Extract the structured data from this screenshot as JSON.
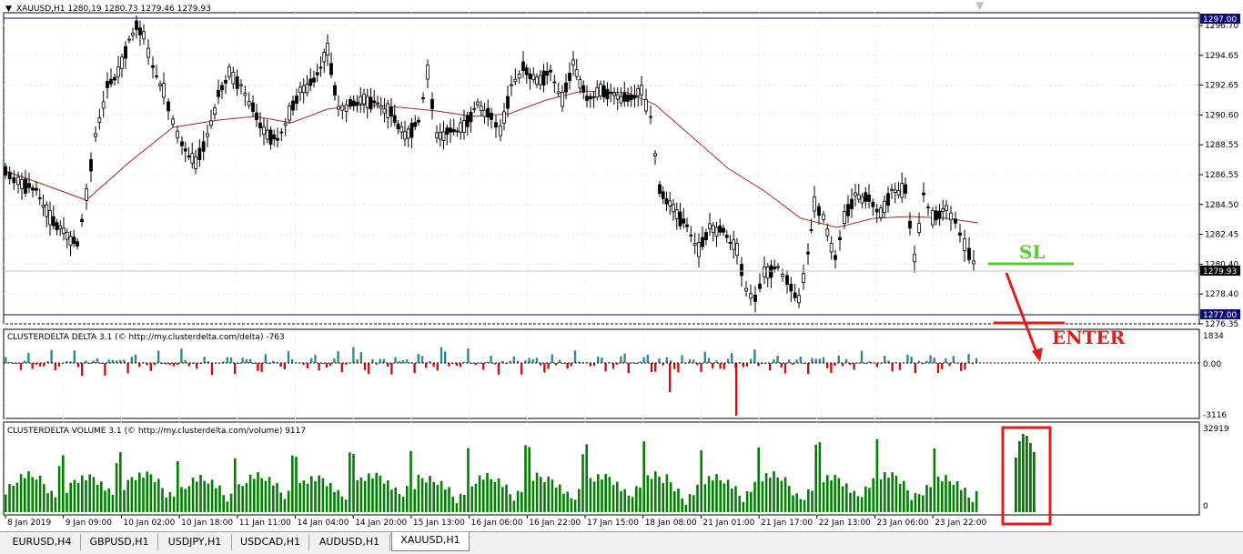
{
  "symbol_header": "XAUUSD,H1  1280,19 1280.73 1279.46 1279.93",
  "price_axis": {
    "labels": [
      "1296.70",
      "1294.65",
      "1292.65",
      "1290.60",
      "1288.55",
      "1286.55",
      "1284.50",
      "1282.45",
      "1280.40",
      "1278.40",
      "1276.35"
    ],
    "top_marker": "1297.00",
    "current_marker": "1279.93",
    "low_marker": "1277.00"
  },
  "annotations": {
    "sl": "SL",
    "enter": "ENTER"
  },
  "delta_indicator": {
    "title": "CLUSTERDELTA DELTA 3.1 (© http://my.clusterdelta.com/delta) -763",
    "axis_top": "1834",
    "axis_mid": "0.00",
    "axis_bottom": "-3116"
  },
  "volume_indicator": {
    "title": "CLUSTERDELTA VOLUME 3.1 (© http://my.clusterdelta.com/volume) 9117",
    "axis_top": "32919",
    "axis_bottom": "0"
  },
  "time_axis": [
    "8 Jan 2019",
    "9 Jan 09:00",
    "10 Jan 02:00",
    "10 Jan 18:00",
    "11 Jan 11:00",
    "14 Jan 04:00",
    "14 Jan 20:00",
    "15 Jan 13:00",
    "16 Jan 06:00",
    "16 Jan 22:00",
    "17 Jan 15:00",
    "18 Jan 08:00",
    "21 Jan 01:00",
    "21 Jan 17:00",
    "22 Jan 13:00",
    "23 Jan 06:00",
    "23 Jan 22:00"
  ],
  "tabs": [
    "EURUSD,H4",
    "GBPUSD,H1",
    "USDJPY,H1",
    "USDCAD,H1",
    "AUDUSD,H1",
    "XAUUSD,H1"
  ],
  "active_tab": "XAUUSD,H1",
  "colors": {
    "bull_delta": "#2e8b8b",
    "bear_delta": "#d01010",
    "volume": "#008000",
    "ma": "#b22222",
    "sl": "#55cc33",
    "enter": "#e21b1b",
    "highlight": "#e21b1b",
    "marker_bg": "#0b0b7a"
  }
}
